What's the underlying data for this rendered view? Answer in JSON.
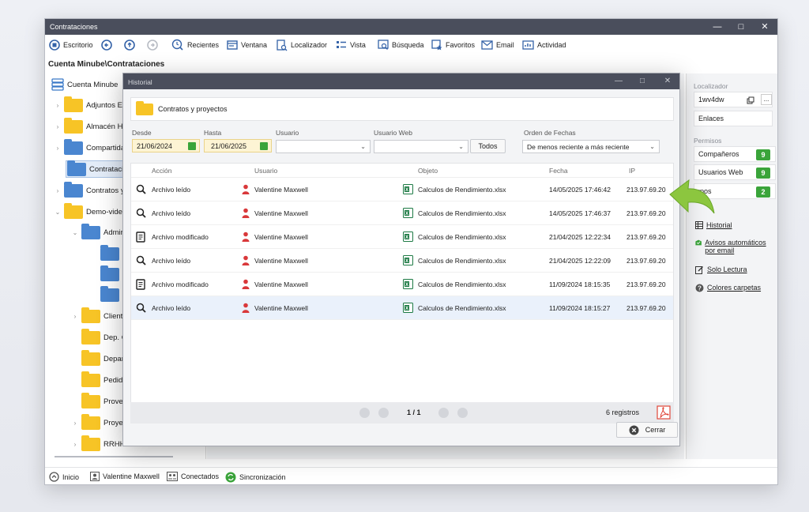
{
  "window": {
    "title": "Contrataciones"
  },
  "toolbar": {
    "items": [
      {
        "label": "Escritorio"
      },
      {
        "label": ""
      },
      {
        "label": ""
      },
      {
        "label": ""
      },
      {
        "label": "Recientes"
      },
      {
        "label": "Ventana"
      },
      {
        "label": "Localizador"
      },
      {
        "label": "Vista"
      },
      {
        "label": "Búsqueda"
      },
      {
        "label": "Favoritos"
      },
      {
        "label": "Email"
      },
      {
        "label": "Actividad"
      }
    ]
  },
  "breadcrumb": "Cuenta Minube\\Contrataciones",
  "tree": {
    "root": "Cuenta Minube",
    "items": [
      {
        "label": "Adjuntos E"
      },
      {
        "label": "Almacén Hi"
      },
      {
        "label": "Compartida"
      },
      {
        "label": "Contratacio"
      },
      {
        "label": "Contratos y"
      },
      {
        "label": "Demo-vide"
      },
      {
        "label": "Admir"
      },
      {
        "label": "Cliente"
      },
      {
        "label": "Dep. C"
      },
      {
        "label": "Depar"
      },
      {
        "label": "Pedid"
      },
      {
        "label": "Prove"
      },
      {
        "label": "Proye"
      },
      {
        "label": "RRHH"
      }
    ]
  },
  "right_panel": {
    "localizador_label": "Localizador",
    "localizador_value": "1wv4dw",
    "more_label": "...",
    "enlaces": "Enlaces",
    "permisos_label": "Permisos",
    "perms": [
      {
        "label": "Compañeros",
        "count": "9"
      },
      {
        "label": "Usuarios Web",
        "count": "9"
      },
      {
        "label": "upos",
        "count": "2"
      }
    ],
    "links": [
      {
        "label": "Historial"
      },
      {
        "label": "Avisos automáticos por email"
      },
      {
        "label": "Solo Lectura"
      },
      {
        "label": "Colores carpetas"
      }
    ]
  },
  "status": {
    "inicio": "Inicio",
    "user": "Valentine Maxwell",
    "conectados": "Conectados",
    "sync": "Sincronización"
  },
  "dialog": {
    "title": "Historial",
    "folder": "Contratos y proyectos",
    "filters": {
      "desde_label": "Desde",
      "desde_value": "21/06/2024",
      "hasta_label": "Hasta",
      "hasta_value": "21/06/2025",
      "usuario_label": "Usuario",
      "usuario_web_label": "Usuario Web",
      "todos_label": "Todos",
      "orden_label": "Orden de Fechas",
      "orden_value": "De menos reciente a más reciente"
    },
    "columns": {
      "accion": "Acción",
      "usuario": "Usuario",
      "objeto": "Objeto",
      "fecha": "Fecha",
      "ip": "IP"
    },
    "rows": [
      {
        "icon": "search-icon",
        "accion": "Archivo leído",
        "usuario": "Valentine Maxwell",
        "objeto": "Calculos de Rendimiento.xlsx",
        "fecha": "14/05/2025 17:46:42",
        "ip": "213.97.69.20"
      },
      {
        "icon": "search-icon",
        "accion": "Archivo leído",
        "usuario": "Valentine Maxwell",
        "objeto": "Calculos de Rendimiento.xlsx",
        "fecha": "14/05/2025 17:46:37",
        "ip": "213.97.69.20"
      },
      {
        "icon": "document-icon",
        "accion": "Archivo modificado",
        "usuario": "Valentine Maxwell",
        "objeto": "Calculos de Rendimiento.xlsx",
        "fecha": "21/04/2025 12:22:34",
        "ip": "213.97.69.20"
      },
      {
        "icon": "search-icon",
        "accion": "Archivo leído",
        "usuario": "Valentine Maxwell",
        "objeto": "Calculos de Rendimiento.xlsx",
        "fecha": "21/04/2025 12:22:09",
        "ip": "213.97.69.20"
      },
      {
        "icon": "document-icon",
        "accion": "Archivo modificado",
        "usuario": "Valentine Maxwell",
        "objeto": "Calculos de Rendimiento.xlsx",
        "fecha": "11/09/2024 18:15:35",
        "ip": "213.97.69.20"
      },
      {
        "icon": "search-icon",
        "accion": "Archivo leído",
        "usuario": "Valentine Maxwell",
        "objeto": "Calculos de Rendimiento.xlsx",
        "fecha": "11/09/2024 18:15:27",
        "ip": "213.97.69.20"
      }
    ],
    "pager": {
      "page": "1 / 1",
      "count": "6 registros"
    },
    "close_label": "Cerrar"
  },
  "colors": {
    "titlebar": "#4a4e5c",
    "badge": "#3aa43a",
    "folder_yellow": "#f7c426",
    "folder_blue": "#4a86d0",
    "user_red": "#d9383a",
    "excel_green": "#1d7a44",
    "arrow_green": "#8cc63f",
    "pdf_red": "#e0473a"
  }
}
